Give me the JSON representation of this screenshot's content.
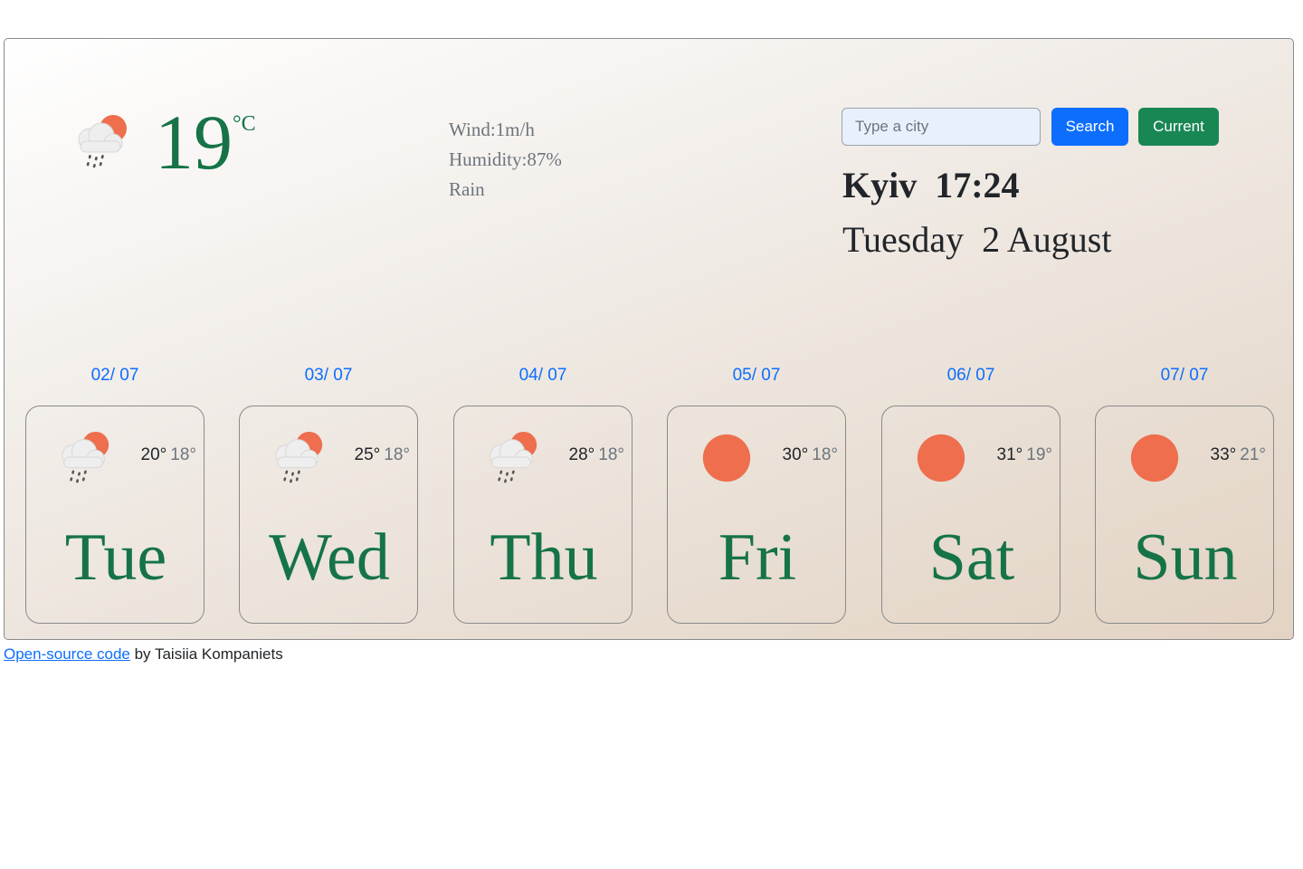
{
  "current": {
    "icon": "rain-cloud-sun-icon",
    "temperature": "19",
    "unit": "°C",
    "wind": "Wind:1m/h",
    "humidity": "Humidity:87%",
    "description": "Rain"
  },
  "search": {
    "placeholder": "Type a city",
    "value": "",
    "search_label": "Search",
    "current_label": "Current"
  },
  "location": {
    "city_time": "Kyiv  17:24",
    "date": "Tuesday  2 August"
  },
  "forecast": [
    {
      "date": "02/ 07",
      "icon": "rain-cloud-sun-icon",
      "max": "20°",
      "min": "18°",
      "day": "Tue"
    },
    {
      "date": "03/ 07",
      "icon": "rain-cloud-sun-icon",
      "max": "25°",
      "min": "18°",
      "day": "Wed"
    },
    {
      "date": "04/ 07",
      "icon": "rain-cloud-sun-icon",
      "max": "28°",
      "min": "18°",
      "day": "Thu"
    },
    {
      "date": "05/ 07",
      "icon": "sun-icon",
      "max": "30°",
      "min": "18°",
      "day": "Fri"
    },
    {
      "date": "06/ 07",
      "icon": "sun-icon",
      "max": "31°",
      "min": "19°",
      "day": "Sat"
    },
    {
      "date": "07/ 07",
      "icon": "sun-icon",
      "max": "33°",
      "min": "21°",
      "day": "Sun"
    }
  ],
  "footer": {
    "link_text": "Open-source code",
    "byline": " by Taisiia Kompaniets"
  },
  "colors": {
    "accent_green": "#157347",
    "button_blue": "#0d6efd",
    "button_green": "#198754",
    "sun": "#ee6e4d"
  }
}
